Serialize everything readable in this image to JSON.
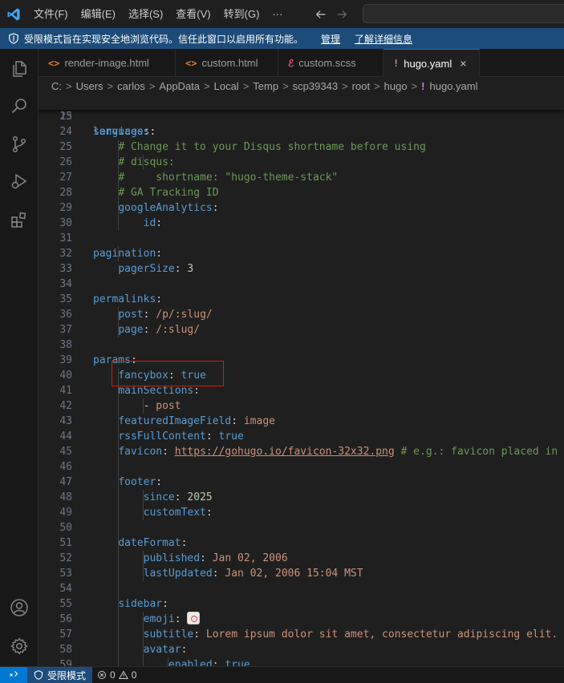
{
  "menu": [
    "文件(F)",
    "编辑(E)",
    "选择(S)",
    "查看(V)",
    "转到(G)",
    "···"
  ],
  "banner": {
    "text": "受限模式旨在实现安全地浏览代码。信任此窗口以启用所有功能。",
    "manage": "管理",
    "learn_more": "了解详细信息"
  },
  "tabs": [
    {
      "label": "render-image.html",
      "icon": "<>",
      "icon_color": "#e37933"
    },
    {
      "label": "custom.html",
      "icon": "<>",
      "icon_color": "#e37933"
    },
    {
      "label": "custom.scss",
      "icon": "ℰ",
      "icon_color": "#f55385"
    },
    {
      "label": "hugo.yaml",
      "icon": "!",
      "icon_color": "#c586c0",
      "active": true,
      "close": "×"
    }
  ],
  "breadcrumb": [
    "C:",
    "Users",
    "carlos",
    "AppData",
    "Local",
    "Temp",
    "scp39343",
    "root",
    "hugo",
    "hugo.yaml"
  ],
  "editor": {
    "sticky": {
      "num": "15",
      "key": "languages"
    },
    "lines": [
      {
        "num": "23",
        "parts": []
      },
      {
        "num": "24",
        "parts": [
          {
            "t": "k",
            "s": "services"
          },
          {
            "t": "p",
            "s": ":"
          }
        ]
      },
      {
        "num": "25",
        "parts": [
          {
            "t": "p",
            "s": "    "
          },
          {
            "t": "c",
            "s": "# Change it to your Disqus shortname before using"
          }
        ]
      },
      {
        "num": "26",
        "parts": [
          {
            "t": "p",
            "s": "    "
          },
          {
            "t": "c",
            "s": "# disqus:"
          }
        ]
      },
      {
        "num": "27",
        "parts": [
          {
            "t": "p",
            "s": "    "
          },
          {
            "t": "c",
            "s": "#     shortname: \"hugo-theme-stack\""
          }
        ]
      },
      {
        "num": "28",
        "parts": [
          {
            "t": "p",
            "s": "    "
          },
          {
            "t": "c",
            "s": "# GA Tracking ID"
          }
        ]
      },
      {
        "num": "29",
        "parts": [
          {
            "t": "p",
            "s": "    "
          },
          {
            "t": "k",
            "s": "googleAnalytics"
          },
          {
            "t": "p",
            "s": ":"
          }
        ]
      },
      {
        "num": "30",
        "parts": [
          {
            "t": "p",
            "s": "        "
          },
          {
            "t": "k",
            "s": "id"
          },
          {
            "t": "p",
            "s": ":"
          }
        ]
      },
      {
        "num": "31",
        "parts": []
      },
      {
        "num": "32",
        "parts": [
          {
            "t": "k",
            "s": "pagination"
          },
          {
            "t": "p",
            "s": ":"
          }
        ]
      },
      {
        "num": "33",
        "parts": [
          {
            "t": "p",
            "s": "    "
          },
          {
            "t": "k",
            "s": "pagerSize"
          },
          {
            "t": "p",
            "s": ": "
          },
          {
            "t": "n",
            "s": "3"
          }
        ]
      },
      {
        "num": "34",
        "parts": []
      },
      {
        "num": "35",
        "parts": [
          {
            "t": "k",
            "s": "permalinks"
          },
          {
            "t": "p",
            "s": ":"
          }
        ]
      },
      {
        "num": "36",
        "parts": [
          {
            "t": "p",
            "s": "    "
          },
          {
            "t": "k",
            "s": "post"
          },
          {
            "t": "p",
            "s": ": "
          },
          {
            "t": "v",
            "s": "/p/:slug/"
          }
        ]
      },
      {
        "num": "37",
        "parts": [
          {
            "t": "p",
            "s": "    "
          },
          {
            "t": "k",
            "s": "page"
          },
          {
            "t": "p",
            "s": ": "
          },
          {
            "t": "v",
            "s": "/:slug/"
          }
        ]
      },
      {
        "num": "38",
        "parts": []
      },
      {
        "num": "39",
        "parts": [
          {
            "t": "k",
            "s": "params"
          },
          {
            "t": "p",
            "s": ":"
          }
        ]
      },
      {
        "num": "40",
        "parts": [
          {
            "t": "p",
            "s": "    "
          },
          {
            "t": "k",
            "s": "fancybox"
          },
          {
            "t": "p",
            "s": ": "
          },
          {
            "t": "b",
            "s": "true"
          }
        ]
      },
      {
        "num": "41",
        "parts": [
          {
            "t": "p",
            "s": "    "
          },
          {
            "t": "k",
            "s": "mainSections"
          },
          {
            "t": "p",
            "s": ":"
          }
        ]
      },
      {
        "num": "42",
        "parts": [
          {
            "t": "p",
            "s": "        - "
          },
          {
            "t": "v",
            "s": "post"
          }
        ]
      },
      {
        "num": "43",
        "parts": [
          {
            "t": "p",
            "s": "    "
          },
          {
            "t": "k",
            "s": "featuredImageField"
          },
          {
            "t": "p",
            "s": ": "
          },
          {
            "t": "v",
            "s": "image"
          }
        ]
      },
      {
        "num": "44",
        "parts": [
          {
            "t": "p",
            "s": "    "
          },
          {
            "t": "k",
            "s": "rssFullContent"
          },
          {
            "t": "p",
            "s": ": "
          },
          {
            "t": "b",
            "s": "true"
          }
        ]
      },
      {
        "num": "45",
        "parts": [
          {
            "t": "p",
            "s": "    "
          },
          {
            "t": "k",
            "s": "favicon"
          },
          {
            "t": "p",
            "s": ": "
          },
          {
            "t": "u",
            "s": "https://gohugo.io/favicon-32x32.png"
          },
          {
            "t": "c",
            "s": " # e.g.: favicon placed in `st"
          }
        ]
      },
      {
        "num": "46",
        "parts": []
      },
      {
        "num": "47",
        "parts": [
          {
            "t": "p",
            "s": "    "
          },
          {
            "t": "k",
            "s": "footer"
          },
          {
            "t": "p",
            "s": ":"
          }
        ]
      },
      {
        "num": "48",
        "parts": [
          {
            "t": "p",
            "s": "        "
          },
          {
            "t": "k",
            "s": "since"
          },
          {
            "t": "p",
            "s": ": "
          },
          {
            "t": "n",
            "s": "2025"
          }
        ]
      },
      {
        "num": "49",
        "parts": [
          {
            "t": "p",
            "s": "        "
          },
          {
            "t": "k",
            "s": "customText"
          },
          {
            "t": "p",
            "s": ":"
          }
        ]
      },
      {
        "num": "50",
        "parts": []
      },
      {
        "num": "51",
        "parts": [
          {
            "t": "p",
            "s": "    "
          },
          {
            "t": "k",
            "s": "dateFormat"
          },
          {
            "t": "p",
            "s": ":"
          }
        ]
      },
      {
        "num": "52",
        "parts": [
          {
            "t": "p",
            "s": "        "
          },
          {
            "t": "k",
            "s": "published"
          },
          {
            "t": "p",
            "s": ": "
          },
          {
            "t": "v",
            "s": "Jan 02, 2006"
          }
        ]
      },
      {
        "num": "53",
        "parts": [
          {
            "t": "p",
            "s": "        "
          },
          {
            "t": "k",
            "s": "lastUpdated"
          },
          {
            "t": "p",
            "s": ": "
          },
          {
            "t": "v",
            "s": "Jan 02, 2006 15:04 MST"
          }
        ]
      },
      {
        "num": "54",
        "parts": []
      },
      {
        "num": "55",
        "parts": [
          {
            "t": "p",
            "s": "    "
          },
          {
            "t": "k",
            "s": "sidebar"
          },
          {
            "t": "p",
            "s": ":"
          }
        ]
      },
      {
        "num": "56",
        "parts": [
          {
            "t": "p",
            "s": "        "
          },
          {
            "t": "k",
            "s": "emoji"
          },
          {
            "t": "p",
            "s": ": "
          },
          {
            "t": "e",
            "s": ""
          }
        ]
      },
      {
        "num": "57",
        "parts": [
          {
            "t": "p",
            "s": "        "
          },
          {
            "t": "k",
            "s": "subtitle"
          },
          {
            "t": "p",
            "s": ": "
          },
          {
            "t": "v",
            "s": "Lorem ipsum dolor sit amet, consectetur adipiscing elit."
          }
        ]
      },
      {
        "num": "58",
        "parts": [
          {
            "t": "p",
            "s": "        "
          },
          {
            "t": "k",
            "s": "avatar"
          },
          {
            "t": "p",
            "s": ":"
          }
        ]
      },
      {
        "num": "59",
        "parts": [
          {
            "t": "p",
            "s": "            "
          },
          {
            "t": "k",
            "s": "enabled"
          },
          {
            "t": "p",
            "s": ": "
          },
          {
            "t": "b",
            "s": "true"
          }
        ]
      }
    ]
  },
  "status": {
    "restricted": "受限模式",
    "errors": "0",
    "warnings": "0"
  },
  "colors": {
    "accent": "#0078d4",
    "banner": "#1d4c7a",
    "highlight": "#e51400"
  }
}
